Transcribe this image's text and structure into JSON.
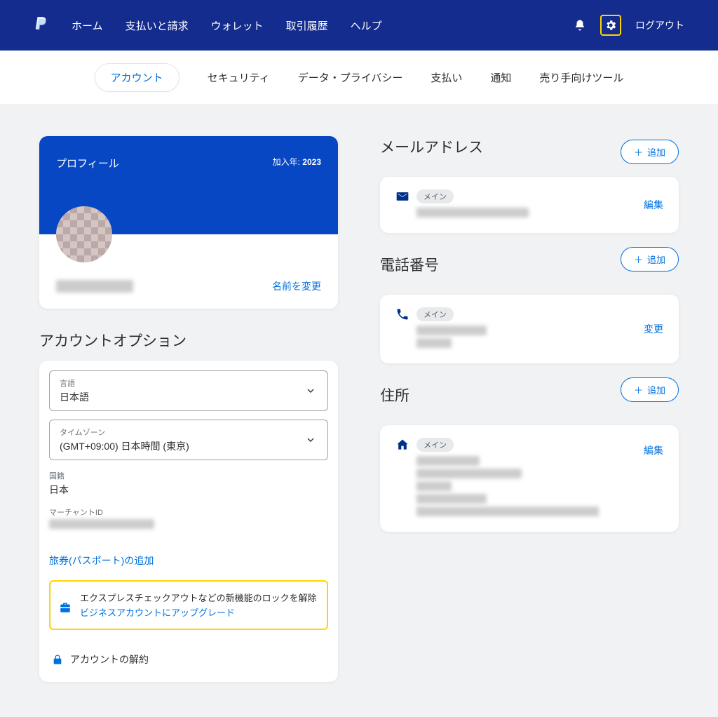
{
  "topnav": {
    "home": "ホーム",
    "payments": "支払いと請求",
    "wallet": "ウォレット",
    "activity": "取引履歴",
    "help": "ヘルプ"
  },
  "logout": "ログアウト",
  "subnav": {
    "account": "アカウント",
    "security": "セキュリティ",
    "privacy": "データ・プライバシー",
    "payment": "支払い",
    "notification": "通知",
    "seller": "売り手向けツール"
  },
  "profile": {
    "title": "プロフィール",
    "joined_label": "加入年:",
    "joined_year": "2023",
    "rename": "名前を変更"
  },
  "options": {
    "title": "アカウントオプション",
    "lang_label": "言語",
    "lang_value": "日本語",
    "tz_label": "タイムゾーン",
    "tz_value": "(GMT+09:00) 日本時間 (東京)",
    "nation_label": "国籍",
    "nation_value": "日本",
    "merchant_label": "マーチャントID",
    "passport_link": "旅券(パスポート)の追加",
    "upgrade_text": "エクスプレスチェックアウトなどの新機能のロックを解除",
    "upgrade_link": "ビジネスアカウントにアップグレード",
    "close_account": "アカウントの解約"
  },
  "email": {
    "title": "メールアドレス",
    "add": "追加",
    "badge": "メイン",
    "edit": "編集"
  },
  "phone": {
    "title": "電話番号",
    "add": "追加",
    "badge": "メイン",
    "edit": "変更"
  },
  "address": {
    "title": "住所",
    "add": "追加",
    "badge": "メイン",
    "edit": "編集"
  }
}
